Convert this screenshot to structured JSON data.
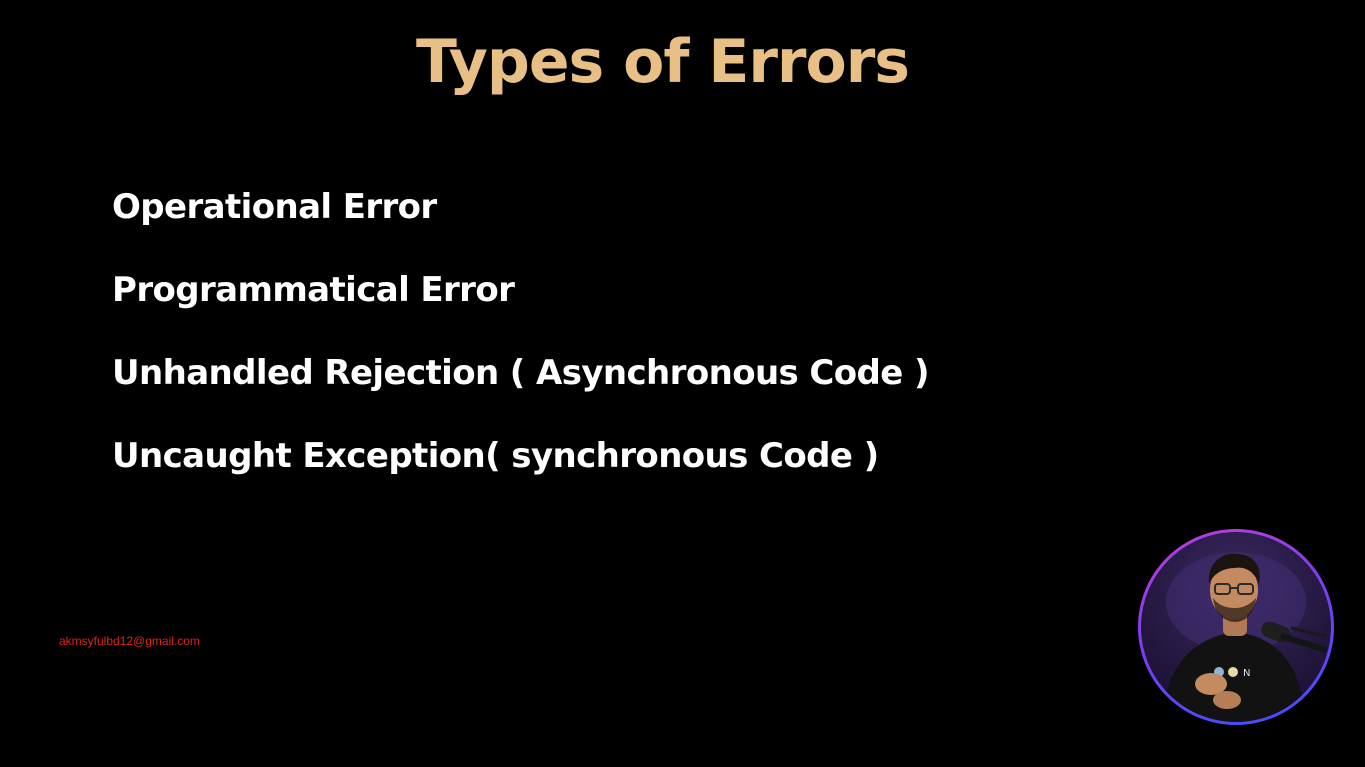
{
  "slide": {
    "title": "Types of Errors",
    "items": [
      "Operational Error",
      "Programmatical Error",
      "Unhandled Rejection ( Asynchronous Code )",
      "Uncaught Exception( synchronous Code )"
    ],
    "watermark": "akmsyfulbd12@gmail.com"
  },
  "colors": {
    "background": "#000000",
    "title": "#E8BF85",
    "item_text": "#ffffff",
    "watermark": "#e0231c",
    "presenter_ring": [
      "#c33fd8",
      "#7d3cf2",
      "#3a52ff"
    ]
  },
  "icons": {
    "presenter_video": "presenter-webcam-avatar"
  }
}
